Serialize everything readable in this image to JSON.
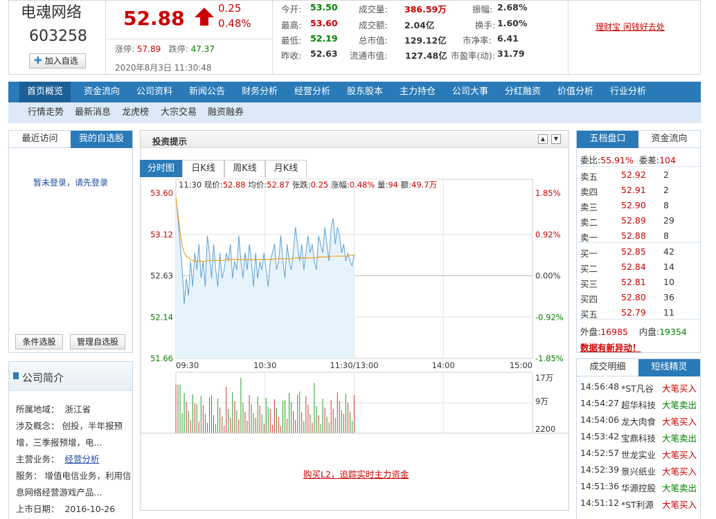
{
  "stock": {
    "name": "电魂网络",
    "code": "603258",
    "add_watch": "加入自选",
    "price": "52.88",
    "change": "0.25",
    "change_pct": "0.48%",
    "limit_up_label": "涨停:",
    "limit_up": "57.89",
    "limit_down_label": "跌停:",
    "limit_down": "47.37",
    "datetime": "2020年8月3日 11:30:48"
  },
  "stats": [
    {
      "label": "今开:",
      "value": "53.50",
      "color": "green"
    },
    {
      "label": "最高:",
      "value": "53.60",
      "color": "red"
    },
    {
      "label": "最低:",
      "value": "52.19",
      "color": "green"
    },
    {
      "label": "昨收:",
      "value": "52.63",
      "color": "normal"
    },
    {
      "label": "成交量:",
      "value": "386.59万",
      "color": "red"
    },
    {
      "label": "成交额:",
      "value": "2.04亿",
      "color": "normal"
    },
    {
      "label": "总市值:",
      "value": "129.12亿",
      "color": "normal"
    },
    {
      "label": "流通市值:",
      "value": "127.48亿",
      "color": "normal"
    },
    {
      "label": "振幅:",
      "value": "2.68%",
      "color": "normal"
    },
    {
      "label": "换手:",
      "value": "1.60%",
      "color": "normal"
    },
    {
      "label": "市净率:",
      "value": "6.41",
      "color": "normal"
    },
    {
      "label": "市盈率(动):",
      "value": "31.79",
      "color": "normal"
    }
  ],
  "ad_link": "理财宝 闲钱好去处",
  "nav": [
    "首页概览",
    "资金流向",
    "公司资料",
    "新闻公告",
    "财务分析",
    "经营分析",
    "股东股本",
    "主力持仓",
    "公司大事",
    "分红融资",
    "价值分析",
    "行业分析"
  ],
  "subnav": [
    "行情走势",
    "最新消息",
    "龙虎榜",
    "大宗交易",
    "融资融券"
  ],
  "left": {
    "tabs": [
      "最近访问",
      "我的自选股"
    ],
    "not_logged_in": "暂未登录，请先登录",
    "btn_filter": "条件选股",
    "btn_manage": "管理自选股"
  },
  "intro": {
    "title": "公司简介",
    "region_label": "所属地域：",
    "region": "浙江省",
    "concept_label": "涉及概念：",
    "concept_line1": "创投，半年报预",
    "concept_line2": "增，三季报预增，电...",
    "business_label": "主营业务：",
    "business_link": "经营分析",
    "service_label": "服务：",
    "service_line1": "增值电信业务，利用信",
    "service_line2": "息网络经营游戏产品...",
    "listing_label": "上市日期：",
    "listing_date": "2016-10-26"
  },
  "center": {
    "title": "投资提示",
    "tabs": [
      "分时图",
      "日K线",
      "周K线",
      "月K线"
    ],
    "info_time": "11:30",
    "info_price_label": "现价:",
    "info_price": "52.88",
    "info_avg_label": "均价:",
    "info_avg": "52.87",
    "info_chg_label": "张跌:",
    "info_chg": "0.25",
    "info_pct_label": "涨幅:",
    "info_pct": "0.48%",
    "info_vol_label": "量:",
    "info_vol": "94",
    "info_amt_label": "额:",
    "info_amt": "49.7万",
    "buy_l2": "购买L2，追踪实时主力资金"
  },
  "chart_data": {
    "type": "line",
    "price_ticks": [
      "53.60",
      "53.12",
      "52.63",
      "52.14",
      "51.66"
    ],
    "pct_ticks": [
      "1.85%",
      "0.92%",
      "0.00%",
      "-0.92%",
      "-1.85%"
    ],
    "time_ticks": [
      "09:30",
      "10:30",
      "11:30/13:00",
      "14:00",
      "15:00"
    ],
    "ylim": [
      51.66,
      53.6
    ],
    "prev_close": 52.63,
    "vol_ticks": [
      "17万",
      "9万",
      "2200"
    ],
    "series": [
      {
        "values": [
          53.55,
          53.3,
          53.0,
          52.7,
          52.3,
          52.6,
          52.4,
          52.8,
          52.5,
          52.9,
          52.7,
          53.0,
          52.6,
          52.8,
          52.5,
          53.1,
          52.9,
          52.6,
          53.0,
          52.7,
          52.5,
          52.9,
          52.6,
          52.7,
          52.9,
          52.8,
          53.0,
          52.6,
          52.8,
          52.7,
          53.1,
          52.8,
          52.6,
          52.9,
          52.7,
          53.0,
          52.8,
          52.5,
          52.9,
          52.6,
          52.8,
          52.7,
          52.9,
          52.7,
          52.5,
          52.8,
          52.9,
          53.0,
          52.7,
          52.8,
          53.1,
          52.8,
          52.6,
          53.0,
          52.8,
          52.7,
          52.9,
          53.2,
          53.0,
          52.8,
          53.0,
          52.7,
          52.9,
          53.1,
          52.9,
          53.0,
          52.8,
          52.7,
          53.1,
          53.0,
          52.9,
          53.2,
          53.0,
          52.8,
          53.2,
          53.3,
          53.0,
          53.2,
          53.1,
          52.9,
          53.0,
          52.8,
          52.9,
          52.8,
          52.75,
          52.88
        ]
      },
      {
        "values": [
          53.55,
          53.35,
          53.15,
          52.98,
          52.9,
          52.86,
          52.84,
          52.82,
          52.81,
          52.8,
          52.8,
          52.8,
          52.8,
          52.8,
          52.8,
          52.81,
          52.81,
          52.81,
          52.81,
          52.81,
          52.81,
          52.81,
          52.81,
          52.81,
          52.82,
          52.82,
          52.82,
          52.82,
          52.82,
          52.82,
          52.82,
          52.82,
          52.82,
          52.82,
          52.82,
          52.82,
          52.82,
          52.82,
          52.82,
          52.82,
          52.82,
          52.82,
          52.82,
          52.82,
          52.82,
          52.82,
          52.82,
          52.83,
          52.83,
          52.83,
          52.83,
          52.83,
          52.83,
          52.83,
          52.83,
          52.83,
          52.83,
          52.84,
          52.84,
          52.84,
          52.84,
          52.84,
          52.84,
          52.84,
          52.84,
          52.84,
          52.84,
          52.84,
          52.85,
          52.85,
          52.85,
          52.85,
          52.85,
          52.85,
          52.86,
          52.86,
          52.86,
          52.86,
          52.86,
          52.86,
          52.86,
          52.86,
          52.86,
          52.87,
          52.87,
          52.87
        ]
      }
    ]
  },
  "orderbook": {
    "tabs": [
      "五档盘口",
      "资金流向"
    ],
    "ratio_label": "委比:",
    "ratio": "55.91%",
    "diff_label": "委差:",
    "diff": "104",
    "sells": [
      {
        "label": "卖五",
        "price": "52.92",
        "vol": "2"
      },
      {
        "label": "卖四",
        "price": "52.91",
        "vol": "2"
      },
      {
        "label": "卖三",
        "price": "52.90",
        "vol": "8"
      },
      {
        "label": "卖二",
        "price": "52.89",
        "vol": "29"
      },
      {
        "label": "卖一",
        "price": "52.88",
        "vol": "8"
      }
    ],
    "buys": [
      {
        "label": "买一",
        "price": "52.85",
        "vol": "42"
      },
      {
        "label": "买二",
        "price": "52.84",
        "vol": "14"
      },
      {
        "label": "买三",
        "price": "52.81",
        "vol": "10"
      },
      {
        "label": "买四",
        "price": "52.80",
        "vol": "36"
      },
      {
        "label": "买五",
        "price": "52.79",
        "vol": "11"
      }
    ],
    "outer_label": "外盘:",
    "outer": "16985",
    "inner_label": "内盘:",
    "inner": "19354",
    "alert": "数据有新异动！"
  },
  "trades": {
    "tabs": [
      "成交明细",
      "短线精灵"
    ],
    "rows": [
      {
        "time": "14:56:48",
        "name": "*ST凡谷",
        "action": "大笔买入",
        "color": "red"
      },
      {
        "time": "14:54:27",
        "name": "超华科技",
        "action": "大笔卖出",
        "color": "green"
      },
      {
        "time": "14:54:06",
        "name": "龙大肉食",
        "action": "大笔买入",
        "color": "red"
      },
      {
        "time": "14:53:42",
        "name": "宝鼎科技",
        "action": "大笔卖出",
        "color": "green"
      },
      {
        "time": "14:52:57",
        "name": "世龙实业",
        "action": "大笔买入",
        "color": "red"
      },
      {
        "time": "14:52:39",
        "name": "景兴纸业",
        "action": "大笔买入",
        "color": "red"
      },
      {
        "time": "14:51:36",
        "name": "华源控股",
        "action": "大笔卖出",
        "color": "green"
      },
      {
        "time": "14:51:12",
        "name": "*ST利源",
        "action": "大笔买入",
        "color": "red"
      }
    ]
  }
}
